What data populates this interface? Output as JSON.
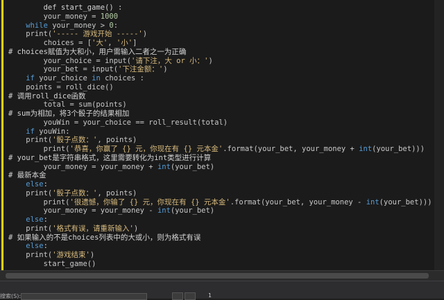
{
  "code": {
    "l1": [
      "        def start_game() :"
    ],
    "l2": [
      "        your_money = ",
      "1000"
    ],
    "l3": [
      "    while",
      " your_money > ",
      "0",
      ":"
    ],
    "l4": [
      "    print(",
      "'----- 游戏开始 -----'",
      ")"
    ],
    "l5": [
      "        choices = [",
      "'大'",
      ", ",
      "'小'",
      "]"
    ],
    "l6": [
      "# choices赋值为大和小，用户需输入二者之一为正确"
    ],
    "l7": [
      "        your_choice = input(",
      "'请下注，大 or 小：'",
      ")"
    ],
    "l8": [
      "        your_bet = input(",
      "'下注金额：'",
      ")"
    ],
    "l9": [
      "    if",
      " your_choice ",
      "in",
      " choices :"
    ],
    "l10": [
      "    points = roll_dice()"
    ],
    "l11": [
      "# 调用roll_dice函数"
    ],
    "l12": [
      "        total = sum(points)"
    ],
    "l13": [
      "# sum为相加，将3个骰子的结果相加"
    ],
    "l14": [
      "        youWin = your_choice == roll_result(total)"
    ],
    "l15": [
      "    if",
      " youWin:"
    ],
    "l16": [
      "    print(",
      "'骰子点数：'",
      ", points)"
    ],
    "l17": [
      "        print(",
      "'恭喜，你赢了 {} 元，你现在有 {} 元本金'",
      ".format(your_bet, your_money + ",
      "int",
      "(your_bet)))"
    ],
    "l18": [
      "# your_bet是字符串格式，这里需要转化为int类型进行计算"
    ],
    "l19": [
      "        your_money = your_money + ",
      "int",
      "(your_bet)"
    ],
    "l20": [
      "# 最新本金"
    ],
    "l21": [
      "    else",
      ":"
    ],
    "l22": [
      "    print(",
      "'骰子点数：'",
      ", points)"
    ],
    "l23": [
      "        print(",
      "'很遗憾，你输了 {} 元，你现在有 {} 元本金'",
      ".format(your_bet, your_money - ",
      "int",
      "(your_bet)))"
    ],
    "l24": [
      "        your_money = your_money - ",
      "int",
      "(your_bet)"
    ],
    "l25": [
      "    else",
      ":"
    ],
    "l26": [
      "    print(",
      "'格式有误，请重新输入'",
      ")"
    ],
    "l27": [
      "# 如果输入的不是choices列表中的大或小，则为格式有误"
    ],
    "l28": [
      "    else",
      ":"
    ],
    "l29": [
      "    print(",
      "'游戏结束'",
      ")"
    ],
    "l30": [
      "        start_game()"
    ]
  },
  "status": {
    "label": "搜索(S):",
    "page": "1"
  },
  "colors": {
    "background": "#1b1b1b",
    "keyword": "#569cd6",
    "string": "#d7ba7d",
    "number": "#b5cea8",
    "change_marker": "#f0d200"
  }
}
